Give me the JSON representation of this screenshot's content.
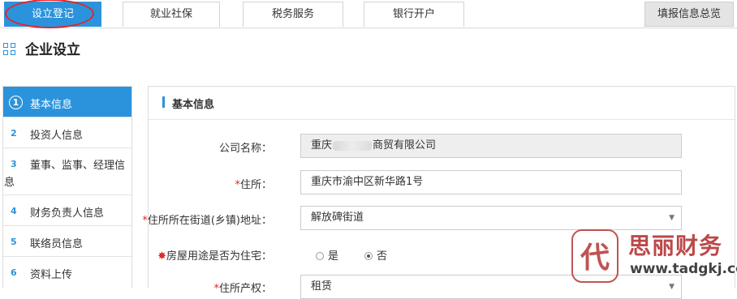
{
  "tabs": [
    {
      "label": "设立登记",
      "active": true
    },
    {
      "label": "就业社保",
      "active": false
    },
    {
      "label": "税务服务",
      "active": false
    },
    {
      "label": "银行开户",
      "active": false
    }
  ],
  "summary_tab": "填报信息总览",
  "page_title": "企业设立",
  "steps": [
    {
      "num": "1",
      "label": "基本信息",
      "active": true
    },
    {
      "num": "2",
      "label": "投资人信息",
      "active": false
    },
    {
      "num": "3",
      "label": "董事、监事、经理信",
      "label2": "息",
      "active": false
    },
    {
      "num": "4",
      "label": "财务负责人信息",
      "active": false
    },
    {
      "num": "5",
      "label": "联络员信息",
      "active": false
    },
    {
      "num": "6",
      "label": "资料上传",
      "active": false
    }
  ],
  "panel": {
    "title": "基本信息",
    "company_name_label": "公司名称：",
    "company_name_prefix": "重庆",
    "company_name_suffix": "商贸有限公司",
    "address_label": "住所：",
    "address_value": "重庆市渝中区新华路1号",
    "street_label": "住所所在街道(乡镇)地址：",
    "street_value": "解放碑街道",
    "residential_label": "房屋用途是否为住宅：",
    "residential_options": [
      "是",
      "否"
    ],
    "residential_selected": "否",
    "property_label": "住所产权：",
    "property_value": "租赁"
  },
  "colors": {
    "accent": "#2b93dc",
    "required": "#e2262a",
    "highlight_circle": "#e2262a"
  },
  "watermark": {
    "name": "思丽财务",
    "url": "www.tadgkj.com",
    "logo_char": "代"
  }
}
